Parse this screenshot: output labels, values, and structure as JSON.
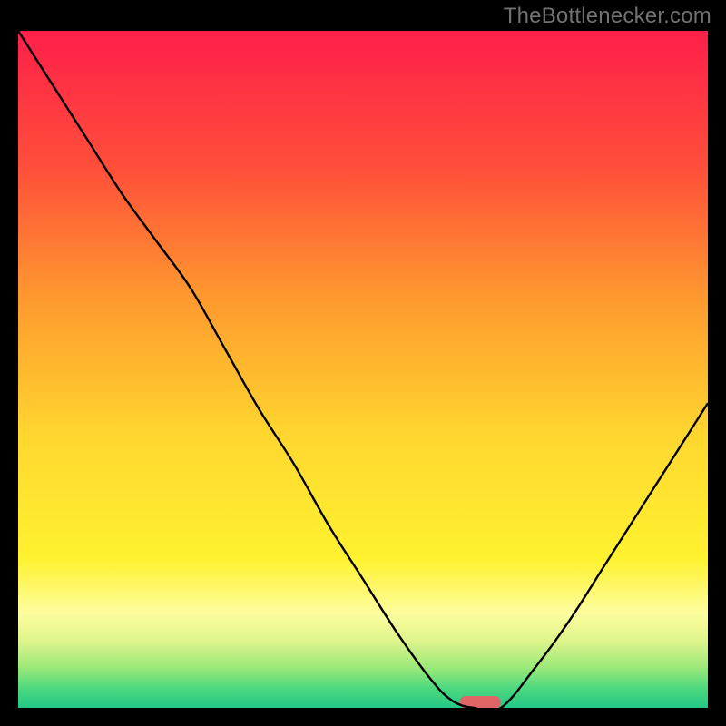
{
  "watermark": "TheBottlenecker.com",
  "chart_data": {
    "type": "line",
    "title": "",
    "xlabel": "",
    "ylabel": "",
    "xlim": [
      0,
      100
    ],
    "ylim": [
      0,
      100
    ],
    "x": [
      0,
      5,
      10,
      15,
      20,
      25,
      30,
      35,
      40,
      45,
      50,
      55,
      60,
      63,
      66,
      70,
      75,
      80,
      85,
      90,
      95,
      100
    ],
    "values": [
      100,
      92,
      84,
      76,
      69,
      62,
      53,
      44,
      36,
      27,
      19,
      11,
      4,
      1,
      0,
      0,
      6,
      13,
      21,
      29,
      37,
      45
    ],
    "optimum_range": {
      "start": 64,
      "end": 70,
      "value": 0
    },
    "gradient_stops": [
      {
        "pct": 0,
        "color": "#ff1f4a"
      },
      {
        "pct": 20,
        "color": "#ff4e3a"
      },
      {
        "pct": 40,
        "color": "#ff9b2e"
      },
      {
        "pct": 60,
        "color": "#ffd72f"
      },
      {
        "pct": 78,
        "color": "#fff22f"
      },
      {
        "pct": 86,
        "color": "#fdfd9e"
      },
      {
        "pct": 90,
        "color": "#dff58c"
      },
      {
        "pct": 94,
        "color": "#9de97a"
      },
      {
        "pct": 97,
        "color": "#4fd97e"
      },
      {
        "pct": 100,
        "color": "#22c985"
      }
    ],
    "marker": {
      "color": "#de6666",
      "rx": 14
    },
    "curve_color": "#000000"
  }
}
